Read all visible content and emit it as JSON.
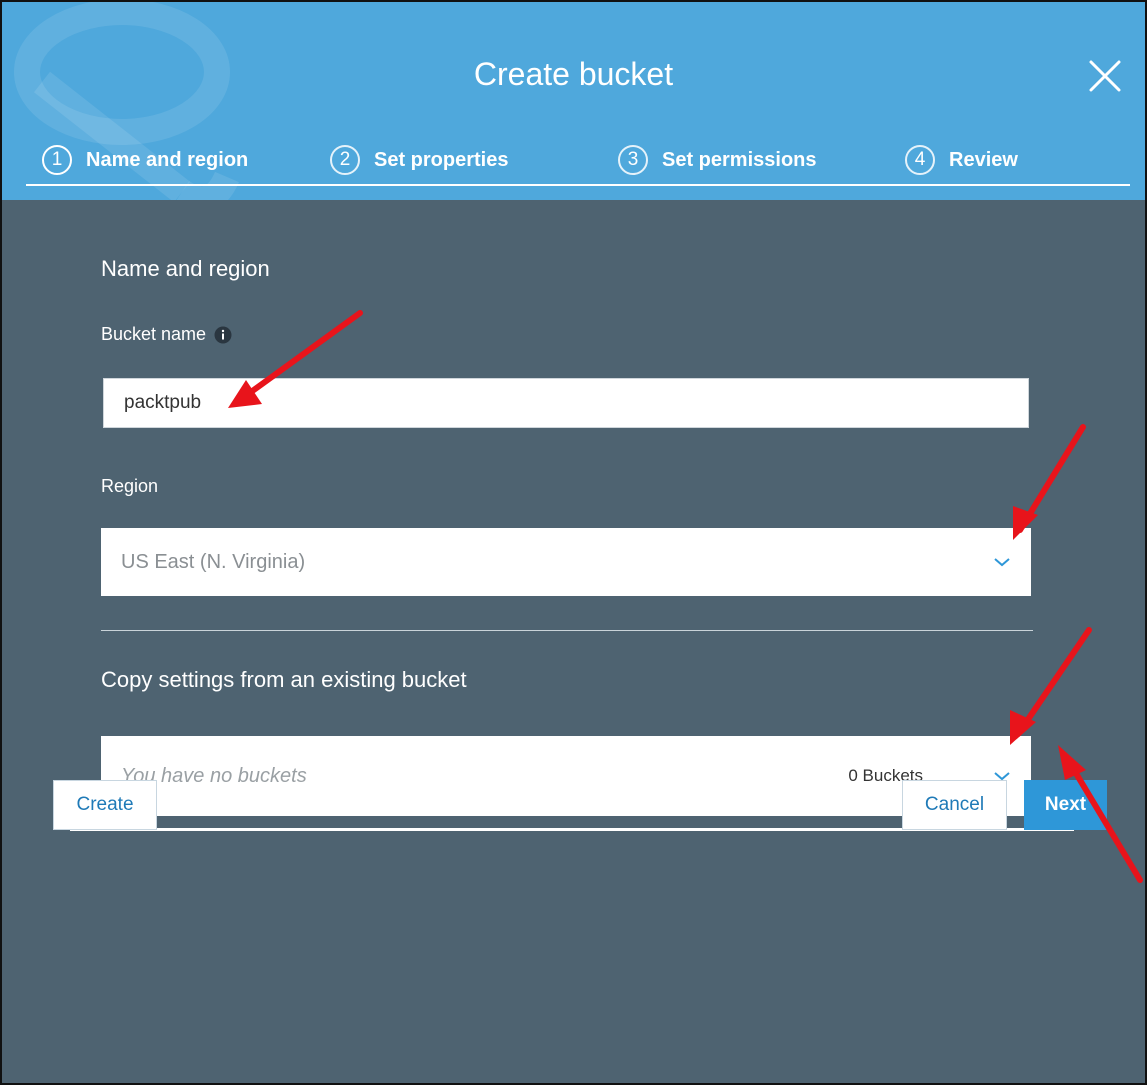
{
  "dialog": {
    "title": "Create bucket",
    "steps": [
      {
        "number": "1",
        "label": "Name and region",
        "active": true
      },
      {
        "number": "2",
        "label": "Set properties",
        "active": false
      },
      {
        "number": "3",
        "label": "Set permissions",
        "active": false
      },
      {
        "number": "4",
        "label": "Review",
        "active": false
      }
    ]
  },
  "form": {
    "section_title": "Name and region",
    "bucket_name_label": "Bucket name",
    "bucket_name_value": "packtpub",
    "region_label": "Region",
    "region_value": "US East (N. Virginia)",
    "copy_settings_label": "Copy settings from an existing bucket",
    "copy_settings_placeholder": "You have no buckets",
    "copy_settings_count": "0 Buckets"
  },
  "footer": {
    "create_label": "Create",
    "cancel_label": "Cancel",
    "next_label": "Next"
  },
  "colors": {
    "header": "#4fa8dc",
    "body": "#4e6371",
    "primary": "#2e97d8",
    "annotation_arrow": "#e8141b"
  },
  "icons": {
    "close": "close-icon",
    "info": "info-icon",
    "chevron": "chevron-down-icon"
  }
}
